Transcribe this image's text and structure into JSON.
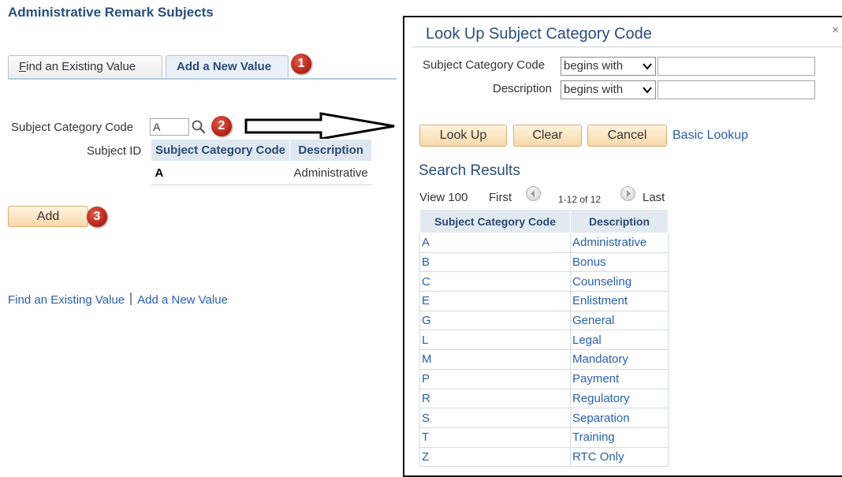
{
  "page": {
    "title": "Administrative Remark Subjects"
  },
  "tabs": {
    "find_prefix": "F",
    "find_rest": "ind an Existing Value",
    "add": "Add a New Value"
  },
  "form": {
    "subject_category_label": "Subject Category Code",
    "subject_category_value": "A",
    "subject_id_label": "Subject ID",
    "add_button": "Add"
  },
  "dropdown": {
    "headers": [
      "Subject Category Code",
      "Description"
    ],
    "row": {
      "code": "A",
      "description": "Administrative"
    }
  },
  "badges": [
    "1",
    "2",
    "3"
  ],
  "bottom_links": {
    "find": "Find an Existing Value",
    "add": "Add a New Value"
  },
  "lookup": {
    "title": "Look Up Subject Category Code",
    "close": "×",
    "fields": [
      {
        "label": "Subject Category Code",
        "operator": "begins with",
        "value": ""
      },
      {
        "label": "Description",
        "operator": "begins with",
        "value": ""
      }
    ],
    "buttons": {
      "lookup": "Look Up",
      "clear": "Clear",
      "cancel": "Cancel"
    },
    "basic_lookup": "Basic Lookup",
    "results_title": "Search Results",
    "nav": {
      "view": "View 100",
      "first": "First",
      "range": "1-12 of 12",
      "last": "Last"
    },
    "headers": [
      "Subject Category Code",
      "Description"
    ],
    "rows": [
      {
        "code": "A",
        "description": "Administrative"
      },
      {
        "code": "B",
        "description": "Bonus"
      },
      {
        "code": "C",
        "description": "Counseling"
      },
      {
        "code": "E",
        "description": "Enlistment"
      },
      {
        "code": "G",
        "description": "General"
      },
      {
        "code": "L",
        "description": "Legal"
      },
      {
        "code": "M",
        "description": "Mandatory"
      },
      {
        "code": "P",
        "description": "Payment"
      },
      {
        "code": "R",
        "description": "Regulatory"
      },
      {
        "code": "S",
        "description": "Separation"
      },
      {
        "code": "T",
        "description": "Training"
      },
      {
        "code": "Z",
        "description": "RTC Only"
      }
    ]
  },
  "colors": {
    "title": "#294e7d",
    "link": "#2760a8",
    "badge": "#c0291c",
    "button": "#f8d8a8"
  },
  "icons": [
    "search-icon",
    "arrow-icon",
    "chevron-down-icon",
    "previous-icon",
    "next-icon",
    "close-icon"
  ]
}
